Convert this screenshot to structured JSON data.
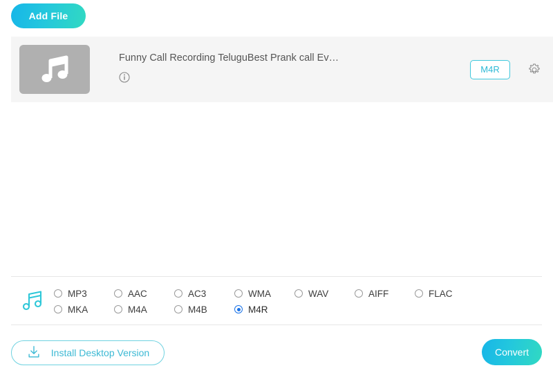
{
  "toolbar": {
    "add_file_label": "Add File"
  },
  "file_row": {
    "thumbnail_icon": "music-note-icon",
    "title": "Funny Call Recording TeluguBest Prank call Ev…",
    "info_icon": "info-circle-icon",
    "format_badge": "M4R",
    "settings_icon": "gear-icon"
  },
  "format_bar": {
    "icon": "music-note-icon",
    "selected": "M4R",
    "rows": [
      [
        {
          "label": "MP3",
          "selected": false
        },
        {
          "label": "AAC",
          "selected": false
        },
        {
          "label": "AC3",
          "selected": false
        },
        {
          "label": "WMA",
          "selected": false
        },
        {
          "label": "WAV",
          "selected": false
        },
        {
          "label": "AIFF",
          "selected": false
        },
        {
          "label": "FLAC",
          "selected": false
        }
      ],
      [
        {
          "label": "MKA",
          "selected": false
        },
        {
          "label": "M4A",
          "selected": false
        },
        {
          "label": "M4B",
          "selected": false
        },
        {
          "label": "M4R",
          "selected": true
        }
      ]
    ]
  },
  "footer": {
    "install_label": "Install Desktop Version",
    "install_icon": "download-icon",
    "convert_label": "Convert"
  },
  "colors": {
    "accent_start": "#17b6e8",
    "accent_end": "#31d9c2",
    "badge_border": "#3ec8dd",
    "badge_text": "#2cb9d6",
    "radio_selected": "#1a73e8",
    "row_background": "#f5f5f5",
    "thumbnail_background": "#b0b0b0"
  }
}
